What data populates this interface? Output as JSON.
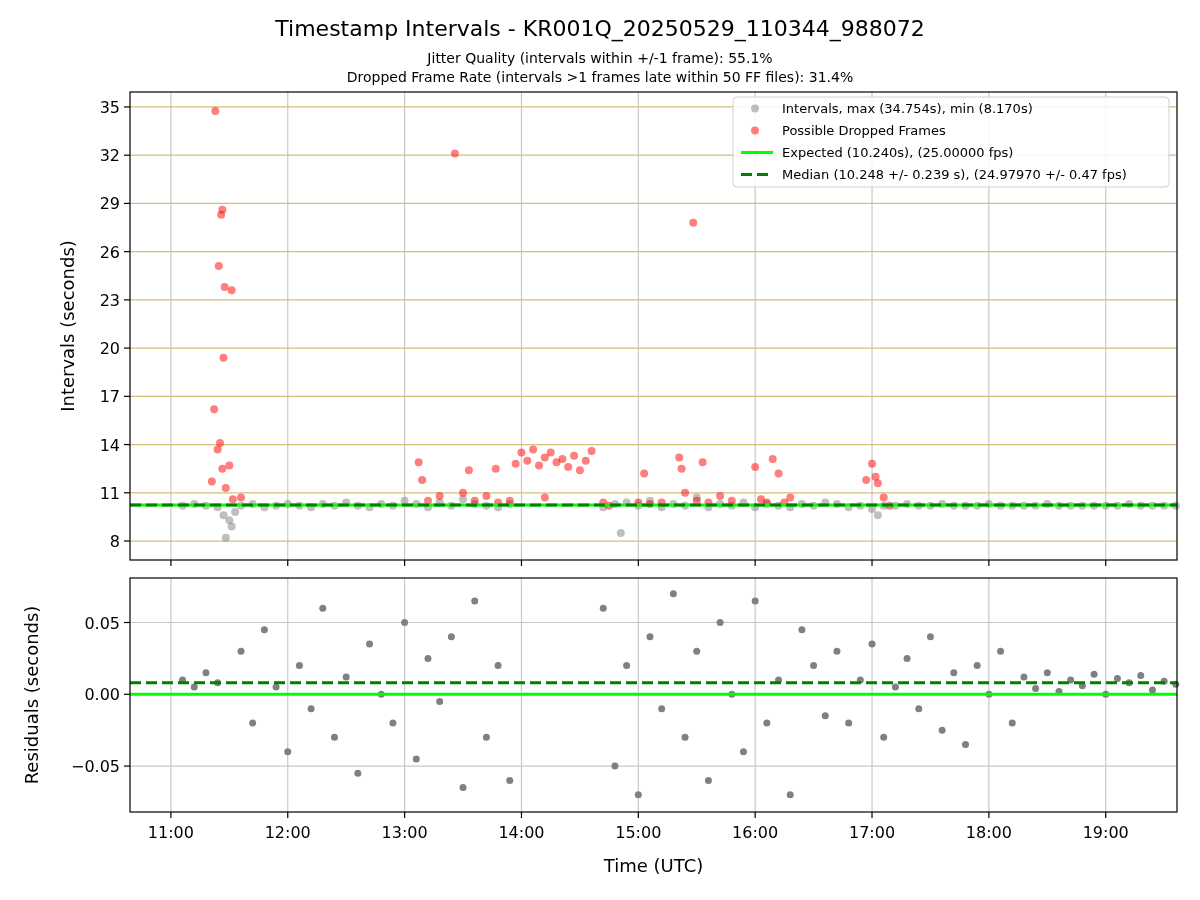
{
  "figure": {
    "title": "Timestamp Intervals - KR001Q_20250529_110344_988072",
    "subtitles": [
      "Jitter Quality (intervals within +/-1 frame): 55.1%",
      "Dropped Frame Rate (intervals >1 frames late within 50 FF files): 31.4%"
    ]
  },
  "plots": [
    {
      "chart_data": {
        "type": "scatter",
        "ylabel": "Intervals (seconds)",
        "xlim": [
          10.65,
          19.61
        ],
        "ylim": [
          6.82,
          35.93
        ],
        "grid": true,
        "yticks": [
          {
            "value": 8,
            "label": "8"
          },
          {
            "value": 11,
            "label": "11"
          },
          {
            "value": 14,
            "label": "14"
          },
          {
            "value": 17,
            "label": "17"
          },
          {
            "value": 20,
            "label": "20"
          },
          {
            "value": 23,
            "label": "23"
          },
          {
            "value": 26,
            "label": "26"
          },
          {
            "value": 29,
            "label": "29"
          },
          {
            "value": 32,
            "label": "32"
          },
          {
            "value": 35,
            "label": "35"
          }
        ],
        "legend": true,
        "series": [
          {
            "name": "Intervals, max (34.754s), min (8.170s)",
            "color": "#808080",
            "type": "scatter",
            "x": [
              11.1,
              11.2,
              11.3,
              11.4,
              11.45,
              11.47,
              11.5,
              11.52,
              11.55,
              11.6,
              11.7,
              11.8,
              11.9,
              12.0,
              12.1,
              12.2,
              12.3,
              12.4,
              12.5,
              12.6,
              12.7,
              12.8,
              12.9,
              13.0,
              13.1,
              13.2,
              13.3,
              13.4,
              13.5,
              13.6,
              13.7,
              13.8,
              13.9,
              14.7,
              14.8,
              14.85,
              14.9,
              15.0,
              15.1,
              15.2,
              15.3,
              15.4,
              15.5,
              15.6,
              15.7,
              15.8,
              15.9,
              16.0,
              16.1,
              16.2,
              16.3,
              16.4,
              16.5,
              16.6,
              16.7,
              16.8,
              16.9,
              17.0,
              17.05,
              17.1,
              17.2,
              17.3,
              17.4,
              17.5,
              17.6,
              17.7,
              17.8,
              17.9,
              18.0,
              18.1,
              18.2,
              18.3,
              18.4,
              18.5,
              18.6,
              18.7,
              18.8,
              18.9,
              19.0,
              19.1,
              19.2,
              19.3,
              19.4,
              19.5,
              19.6
            ],
            "values": [
              10.2,
              10.3,
              10.2,
              10.1,
              9.6,
              8.2,
              9.3,
              8.9,
              9.8,
              10.2,
              10.3,
              10.1,
              10.2,
              10.3,
              10.2,
              10.1,
              10.3,
              10.2,
              10.4,
              10.2,
              10.1,
              10.3,
              10.2,
              10.5,
              10.3,
              10.1,
              10.4,
              10.2,
              10.6,
              10.3,
              10.2,
              10.1,
              10.3,
              10.1,
              10.3,
              8.5,
              10.4,
              10.2,
              10.5,
              10.1,
              10.3,
              10.2,
              10.7,
              10.1,
              10.3,
              10.2,
              10.4,
              10.1,
              10.3,
              10.2,
              10.1,
              10.3,
              10.2,
              10.4,
              10.3,
              10.1,
              10.2,
              10.0,
              9.6,
              10.2,
              10.2,
              10.3,
              10.2,
              10.2,
              10.3,
              10.2,
              10.2,
              10.2,
              10.3,
              10.2,
              10.2,
              10.2,
              10.2,
              10.3,
              10.2,
              10.2,
              10.2,
              10.2,
              10.2,
              10.2,
              10.3,
              10.2,
              10.2,
              10.2,
              10.2
            ]
          },
          {
            "name": "Possible Dropped Frames",
            "color": "#ff0000",
            "type": "scatter",
            "x": [
              11.38,
              11.43,
              11.44,
              11.41,
              11.46,
              11.52,
              11.45,
              11.37,
              11.4,
              11.42,
              11.5,
              11.44,
              11.35,
              11.47,
              11.53,
              11.6,
              13.12,
              13.15,
              13.2,
              13.3,
              13.43,
              13.5,
              13.55,
              13.6,
              13.7,
              13.8,
              13.78,
              13.9,
              13.95,
              14.0,
              14.05,
              14.1,
              14.15,
              14.2,
              14.25,
              14.3,
              14.35,
              14.4,
              14.45,
              14.5,
              14.55,
              14.6,
              14.2,
              14.7,
              14.75,
              15.0,
              15.05,
              15.1,
              15.2,
              15.35,
              15.37,
              15.4,
              15.47,
              15.5,
              15.55,
              15.6,
              15.7,
              15.8,
              16.0,
              16.05,
              16.1,
              16.15,
              16.2,
              16.25,
              16.3,
              16.95,
              17.0,
              17.03,
              17.05,
              17.1,
              17.15
            ],
            "values": [
              34.75,
              28.3,
              28.6,
              25.1,
              23.8,
              23.6,
              19.4,
              16.2,
              13.7,
              14.1,
              12.7,
              12.5,
              11.7,
              11.3,
              10.6,
              10.7,
              12.9,
              11.8,
              10.5,
              10.8,
              32.1,
              11.0,
              12.4,
              10.5,
              10.8,
              10.4,
              12.5,
              10.5,
              12.8,
              13.5,
              13.0,
              13.7,
              12.7,
              13.2,
              13.5,
              12.9,
              13.1,
              12.6,
              13.3,
              12.4,
              13.0,
              13.6,
              10.7,
              10.4,
              10.2,
              10.4,
              12.2,
              10.3,
              10.4,
              13.2,
              12.5,
              11.0,
              27.8,
              10.5,
              12.9,
              10.4,
              10.8,
              10.5,
              12.6,
              10.6,
              10.4,
              13.1,
              12.2,
              10.4,
              10.7,
              11.8,
              12.8,
              12.0,
              11.6,
              10.7,
              10.2
            ]
          },
          {
            "name": "Expected (10.240s), (25.00000 fps)",
            "color": "#00ff00",
            "type": "line",
            "line_style": "solid",
            "x": [
              10.65,
              19.61
            ],
            "values": [
              10.24,
              10.24
            ]
          },
          {
            "name": "Median (10.248 +/- 0.239 s), (24.97970 +/- 0.47 fps)",
            "color": "#008000",
            "type": "line",
            "line_style": "dashed",
            "x": [
              10.65,
              19.61
            ],
            "values": [
              10.248,
              10.248
            ]
          }
        ]
      }
    },
    {
      "chart_data": {
        "type": "scatter",
        "xlabel": "Time (UTC)",
        "ylabel": "Residuals (seconds)",
        "xlim": [
          10.65,
          19.61
        ],
        "ylim": [
          -0.082,
          0.081
        ],
        "grid": true,
        "xticks": [
          {
            "value": 11,
            "label": "11:00"
          },
          {
            "value": 12,
            "label": "12:00"
          },
          {
            "value": 13,
            "label": "13:00"
          },
          {
            "value": 14,
            "label": "14:00"
          },
          {
            "value": 15,
            "label": "15:00"
          },
          {
            "value": 16,
            "label": "16:00"
          },
          {
            "value": 17,
            "label": "17:00"
          },
          {
            "value": 18,
            "label": "18:00"
          },
          {
            "value": 19,
            "label": "19:00"
          }
        ],
        "yticks": [
          {
            "value": -0.05,
            "label": "−0.05"
          },
          {
            "value": 0,
            "label": "0.00"
          },
          {
            "value": 0.05,
            "label": "0.05"
          }
        ],
        "legend": false,
        "series": [
          {
            "color": "#808080",
            "type": "scatter",
            "x": [
              11.1,
              11.2,
              11.3,
              11.4,
              11.6,
              11.7,
              11.8,
              11.9,
              12.0,
              12.1,
              12.2,
              12.3,
              12.4,
              12.5,
              12.6,
              12.7,
              12.8,
              12.9,
              13.0,
              13.1,
              13.2,
              13.3,
              13.4,
              13.5,
              13.6,
              13.7,
              13.8,
              13.9,
              14.7,
              14.8,
              14.9,
              15.0,
              15.1,
              15.2,
              15.3,
              15.4,
              15.5,
              15.6,
              15.7,
              15.8,
              15.9,
              16.0,
              16.1,
              16.2,
              16.3,
              16.4,
              16.5,
              16.6,
              16.7,
              16.8,
              16.9,
              17.0,
              17.1,
              17.2,
              17.3,
              17.4,
              17.5,
              17.6,
              17.7,
              17.8,
              17.9,
              18.0,
              18.1,
              18.2,
              18.3,
              18.4,
              18.5,
              18.6,
              18.7,
              18.8,
              18.9,
              19.0,
              19.1,
              19.2,
              19.3,
              19.4,
              19.5,
              19.6
            ],
            "values": [
              0.01,
              0.005,
              0.015,
              0.008,
              0.03,
              -0.02,
              0.045,
              0.005,
              -0.04,
              0.02,
              -0.01,
              0.06,
              -0.03,
              0.012,
              -0.055,
              0.035,
              0.0,
              -0.02,
              0.05,
              -0.045,
              0.025,
              -0.005,
              0.04,
              -0.065,
              0.065,
              -0.03,
              0.02,
              -0.06,
              0.06,
              -0.05,
              0.02,
              -0.07,
              0.04,
              -0.01,
              0.07,
              -0.03,
              0.03,
              -0.06,
              0.05,
              0.0,
              -0.04,
              0.065,
              -0.02,
              0.01,
              -0.07,
              0.045,
              0.02,
              -0.015,
              0.03,
              -0.02,
              0.01,
              0.035,
              -0.03,
              0.005,
              0.025,
              -0.01,
              0.04,
              -0.025,
              0.015,
              -0.035,
              0.02,
              0.0,
              0.03,
              -0.02,
              0.012,
              0.004,
              0.015,
              0.002,
              0.01,
              0.006,
              0.014,
              0.0,
              0.011,
              0.008,
              0.013,
              0.003,
              0.009,
              0.007
            ]
          },
          {
            "color": "#00ff00",
            "type": "line",
            "line_style": "solid",
            "x": [
              10.65,
              19.61
            ],
            "values": [
              0,
              0
            ]
          },
          {
            "color": "#008000",
            "type": "line",
            "line_style": "dashed",
            "x": [
              10.65,
              19.61
            ],
            "values": [
              0.008,
              0.008
            ]
          }
        ]
      }
    }
  ]
}
